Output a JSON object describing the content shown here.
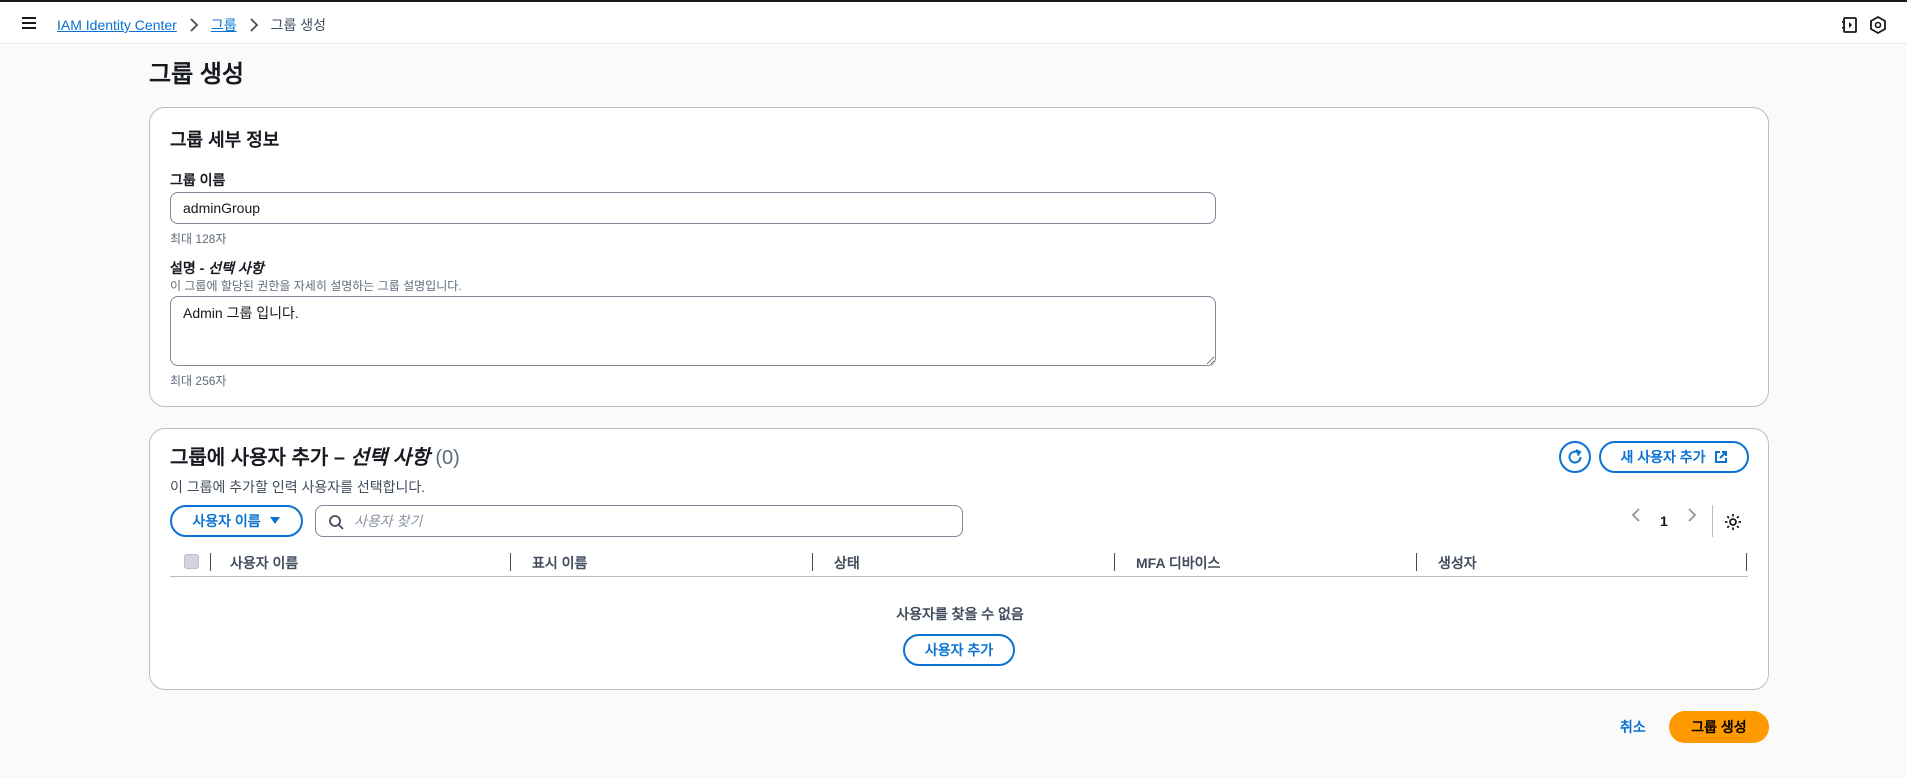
{
  "breadcrumb": {
    "items": [
      {
        "label": "IAM Identity Center"
      },
      {
        "label": "그룹"
      }
    ],
    "current": "그룹 생성"
  },
  "page": {
    "title": "그룹 생성"
  },
  "details": {
    "title": "그룹 세부 정보",
    "name_label": "그룹 이름",
    "name_value": "adminGroup",
    "name_constraint": "최대 128자",
    "desc_label": "설명",
    "desc_label_separator": " - ",
    "desc_label_optional": "선택 사항",
    "desc_hint": "이 그룹에 할당된 권한을 자세히 설명하는 그룹 설명입니다.",
    "desc_value": "Admin 그룹 입니다.",
    "desc_constraint": "최대 256자"
  },
  "users": {
    "title": "그룹에 사용자 추가",
    "separator": " – ",
    "optional": "선택 사항",
    "count": "(0)",
    "description": "이 그룹에 추가할 인력 사용자를 선택합니다.",
    "filter_label": "사용자 이름",
    "search_placeholder": "사용자 찾기",
    "new_user_label": "새 사용자 추가",
    "page": "1",
    "columns": [
      "사용자 이름",
      "표시 이름",
      "상태",
      "MFA 디바이스",
      "생성자"
    ],
    "empty_text": "사용자를 찾을 수 없음",
    "add_user_label": "사용자 추가"
  },
  "footer": {
    "cancel_label": "취소",
    "create_label": "그룹 생성"
  },
  "colors": {
    "link": "#0972d3",
    "primary": "#ff9900",
    "border": "#b6bec9"
  },
  "icons": [
    "menu-icon",
    "chevron-right-icon",
    "notebook-icon",
    "settings-hex-icon",
    "refresh-icon",
    "external-link-icon",
    "caret-down-icon",
    "search-icon",
    "chevron-left-icon",
    "gear-icon"
  ]
}
